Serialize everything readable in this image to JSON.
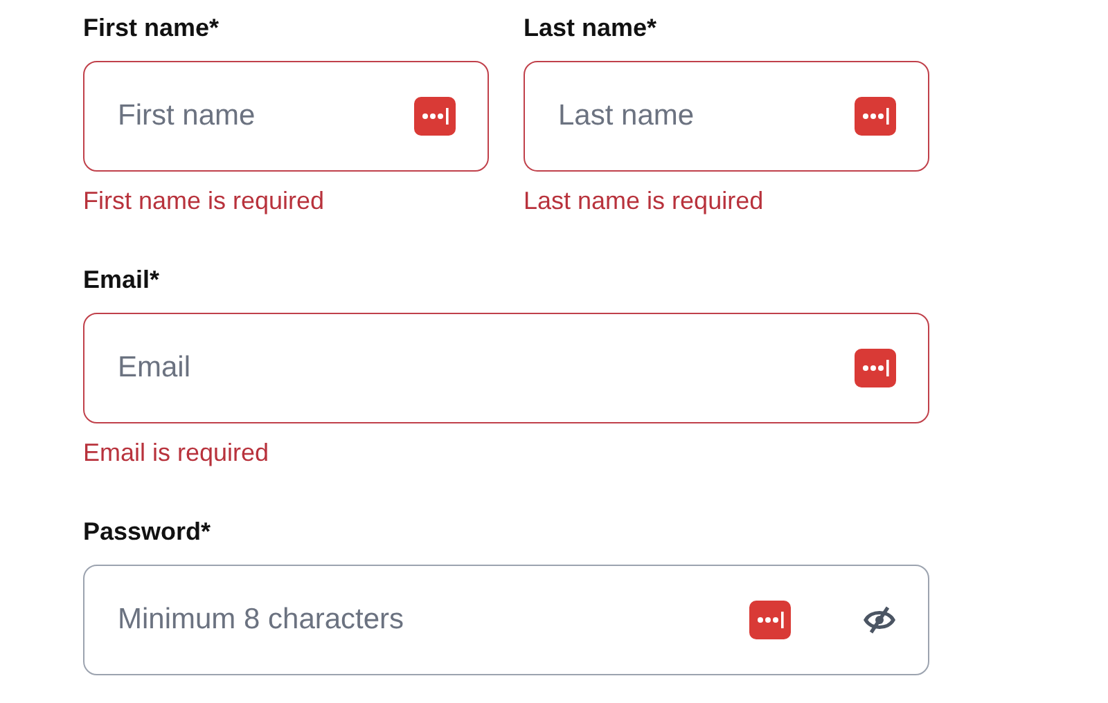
{
  "rows": [
    [
      {
        "kind": "text",
        "label": "First name*",
        "placeholder": "First name",
        "invalid": true,
        "error": "First name is required"
      },
      {
        "kind": "text",
        "label": "Last name*",
        "placeholder": "Last name",
        "invalid": true,
        "error": "Last name is required"
      }
    ],
    [
      {
        "kind": "text",
        "label": "Email*",
        "placeholder": "Email",
        "invalid": true,
        "error": "Email is required"
      }
    ],
    [
      {
        "kind": "password",
        "label": "Password*",
        "placeholder": "Minimum 8 characters",
        "invalid": false,
        "revealed": false
      }
    ]
  ]
}
